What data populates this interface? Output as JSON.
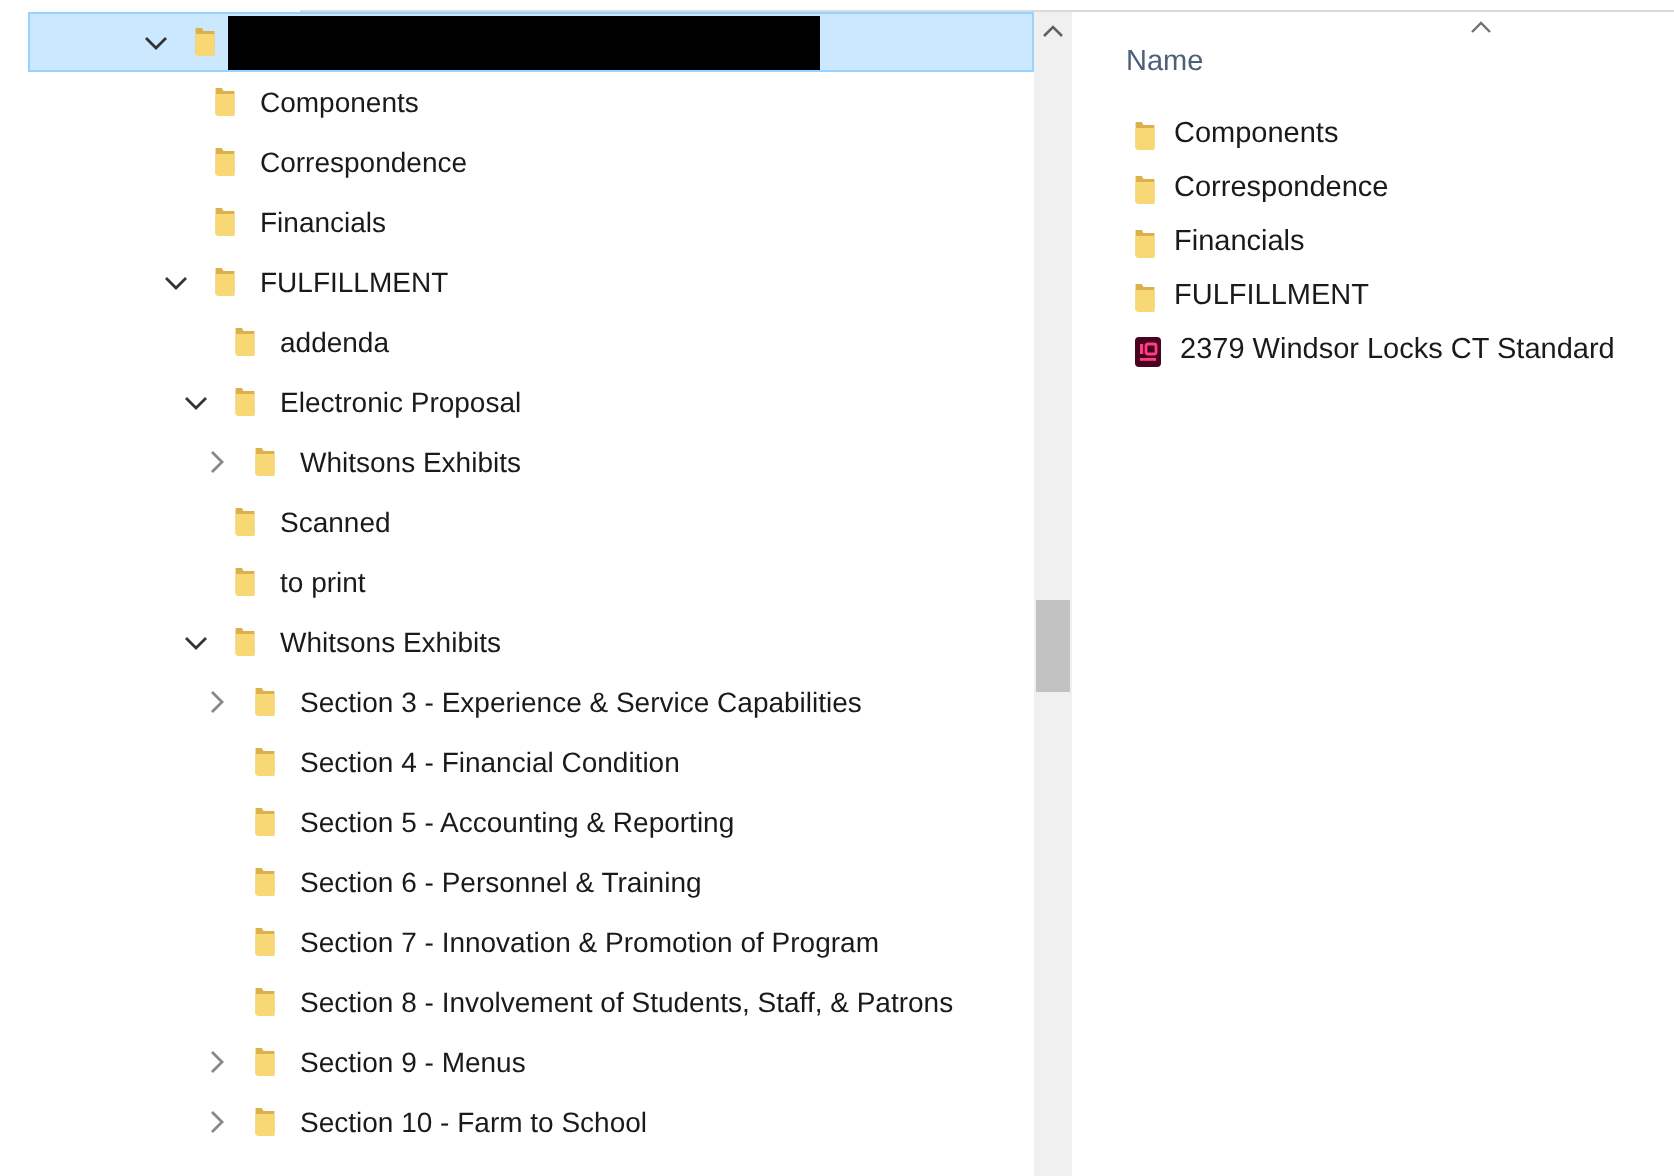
{
  "tree": [
    {
      "redacted": true,
      "expanded": true,
      "selected": true,
      "children": [
        {
          "label": "Components",
          "selected": false
        },
        {
          "label": "Correspondence",
          "selected": false
        },
        {
          "label": "Financials",
          "selected": false
        },
        {
          "label": "FULFILLMENT",
          "expanded": true,
          "selected": false,
          "children": [
            {
              "label": "addenda",
              "selected": false
            },
            {
              "label": "Electronic Proposal",
              "expanded": true,
              "selected": false,
              "children": [
                {
                  "label": "Whitsons Exhibits",
                  "expanded": false,
                  "selected": false
                }
              ]
            },
            {
              "label": "Scanned",
              "selected": false
            },
            {
              "label": "to print",
              "selected": false
            },
            {
              "label": "Whitsons Exhibits",
              "expanded": true,
              "selected": false,
              "children": [
                {
                  "label": "Section 3 - Experience & Service Capabilities",
                  "expanded": false,
                  "selected": false
                },
                {
                  "label": "Section 4 - Financial Condition",
                  "selected": false
                },
                {
                  "label": "Section 5 - Accounting & Reporting",
                  "selected": false
                },
                {
                  "label": "Section 6 - Personnel & Training",
                  "selected": false
                },
                {
                  "label": "Section 7 - Innovation & Promotion of Program",
                  "selected": false
                },
                {
                  "label": "Section 8 - Involvement of Students, Staff, & Patrons",
                  "selected": false
                },
                {
                  "label": "Section 9 - Menus",
                  "expanded": false,
                  "selected": false
                },
                {
                  "label": "Section 10 - Farm to School",
                  "expanded": false,
                  "selected": false
                }
              ]
            }
          ]
        }
      ]
    }
  ],
  "file_list": {
    "column_header": "Name",
    "items": [
      {
        "name": "Components",
        "kind": "folder"
      },
      {
        "name": "Correspondence",
        "kind": "folder"
      },
      {
        "name": "Financials",
        "kind": "folder"
      },
      {
        "name": "FULFILLMENT",
        "kind": "folder"
      },
      {
        "name": "2379 Windsor Locks CT Standard",
        "kind": "indesign"
      }
    ]
  }
}
